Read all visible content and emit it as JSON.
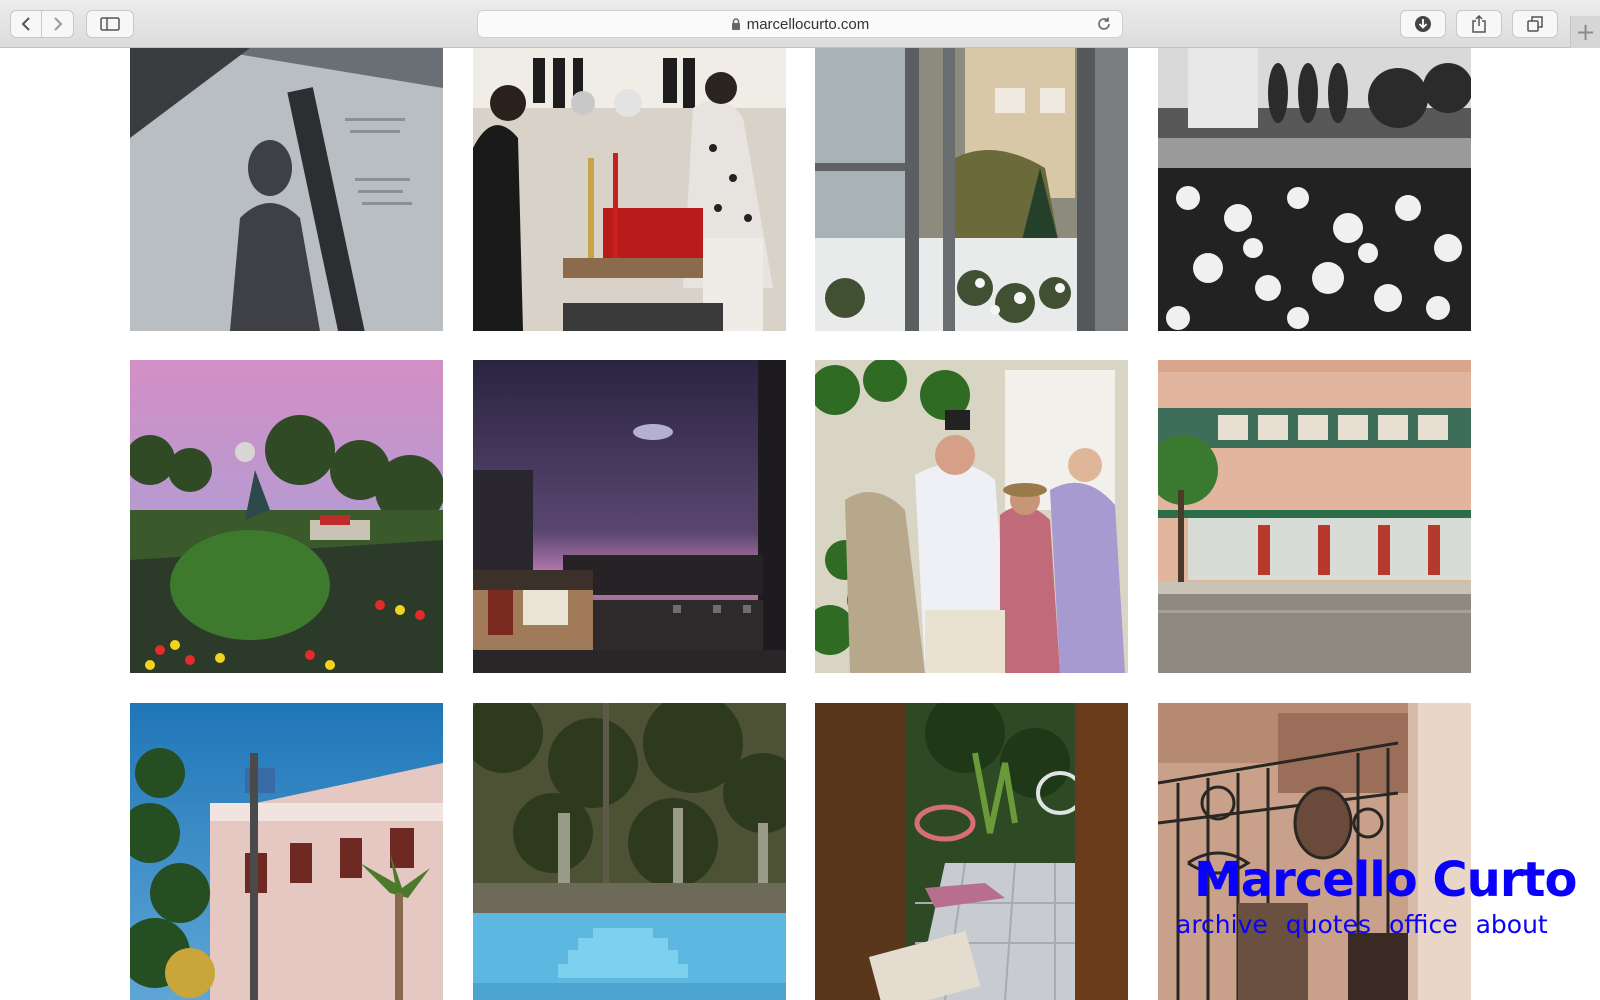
{
  "browser": {
    "url": "marcellocurto.com",
    "icons": {
      "back": "chevron-left-icon",
      "forward": "chevron-right-icon",
      "sidebar": "sidebar-icon",
      "lock": "lock-icon",
      "reload": "reload-icon",
      "download": "download-icon",
      "share": "share-icon",
      "tabs": "tabs-icon",
      "new_tab": "plus-icon"
    },
    "new_tab_glyph": "+"
  },
  "site": {
    "title": "Marcello Curto",
    "nav": [
      "archive",
      "quotes",
      "office",
      "about"
    ],
    "accent": "#0a00ff"
  },
  "photos": [
    {
      "subject": "shadow-on-wall"
    },
    {
      "subject": "shop-interior"
    },
    {
      "subject": "window-garden"
    },
    {
      "subject": "white-flowers-bw"
    },
    {
      "subject": "park-fountain-sunset"
    },
    {
      "subject": "purple-sky-rooftops"
    },
    {
      "subject": "tourists-doorway"
    },
    {
      "subject": "pink-building-street"
    },
    {
      "subject": "pink-mansion-palms"
    },
    {
      "subject": "empty-pool"
    },
    {
      "subject": "door-terrace-chairs"
    },
    {
      "subject": "ornate-iron-gate"
    }
  ]
}
